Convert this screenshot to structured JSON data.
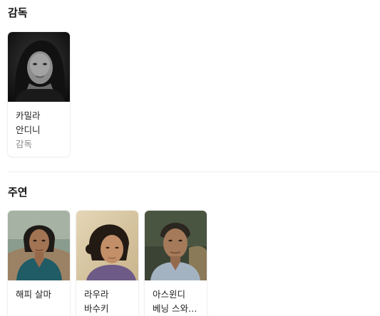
{
  "director_section": {
    "title": "감독",
    "people": [
      {
        "name": "카밀라 안디니",
        "role": "감독",
        "photo_icon": "portrait-woman-bw"
      }
    ]
  },
  "cast_section": {
    "title": "주연",
    "people": [
      {
        "name": "해피 살마",
        "photo_icon": "portrait-woman-teal"
      },
      {
        "name": "라우라 바수키",
        "photo_icon": "portrait-woman-warm"
      },
      {
        "name": "아스윈디 베닝 스와…",
        "photo_icon": "portrait-man-elder"
      }
    ]
  },
  "colors": {
    "text_primary": "#222222",
    "text_secondary": "#8a8a8a",
    "divider": "#eeeeee"
  }
}
